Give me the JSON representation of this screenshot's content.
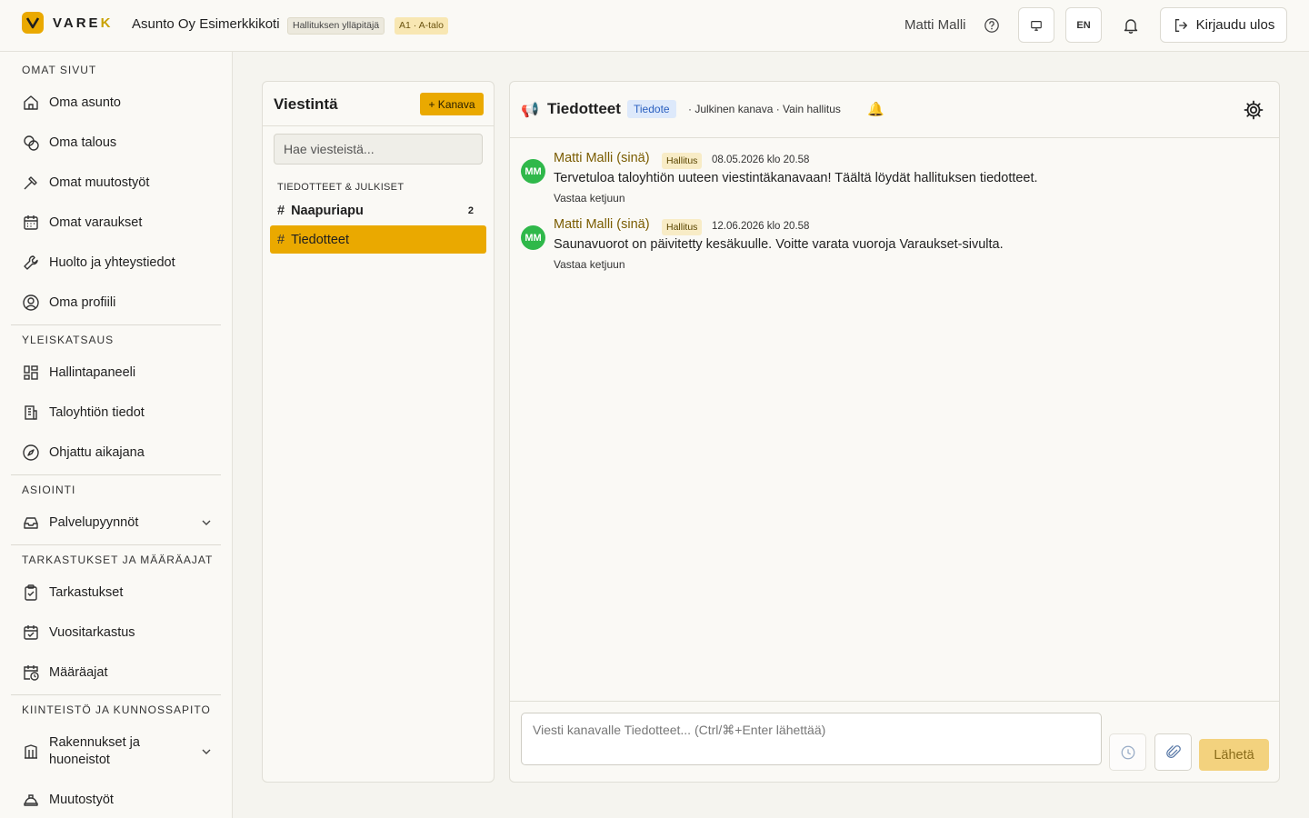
{
  "header": {
    "logo_text_main": "VARE",
    "logo_text_accent": "K",
    "org_name": "Asunto Oy Esimerkkikoti",
    "role_badge": "Hallituksen ylläpitäjä",
    "apartment_badge": "A1 · A-talo",
    "user_name": "Matti Malli",
    "lang_label": "EN",
    "logout_label": "Kirjaudu ulos",
    "accent_color": "#eaa900"
  },
  "sidebar": {
    "sections": [
      {
        "title": "OMAT SIVUT",
        "items": [
          "Oma asunto",
          "Oma talous",
          "Omat muutostyöt",
          "Omat varaukset",
          "Huolto ja yhteystiedot",
          "Oma profiili"
        ]
      },
      {
        "title": "YLEISKATSAUS",
        "items": [
          "Hallintapaneeli",
          "Taloyhtiön tiedot",
          "Ohjattu aikajana"
        ]
      },
      {
        "title": "ASIOINTI",
        "items": [
          "Palvelupyynnöt"
        ]
      },
      {
        "title": "TARKASTUKSET JA MÄÄRÄAJAT",
        "items": [
          "Tarkastukset",
          "Vuositarkastus",
          "Määräajat"
        ]
      },
      {
        "title": "KIINTEISTÖ JA KUNNOSSAPITO",
        "items": [
          "Rakennukset ja",
          "huoneistot",
          "Muutostyöt"
        ]
      }
    ]
  },
  "channels": {
    "title": "Viestintä",
    "add_label": "+ Kanava",
    "search_placeholder": "Hae viesteistä...",
    "group_title": "TIEDOTTEET & JULKISET",
    "items": [
      {
        "hash": "#",
        "name": "Naapuriapu",
        "count": "2"
      },
      {
        "hash": "#",
        "name": "Tiedotteet"
      }
    ]
  },
  "chat": {
    "title": "Tiedotteet",
    "type_badge": "Tiedote",
    "meta": "· Julkinen kanava · Vain hallitus",
    "messages": [
      {
        "initials": "MM",
        "author": "Matti Malli (sinä)",
        "role": "Hallitus",
        "time": "08.05.2026 klo 20.58",
        "text": "Tervetuloa taloyhtiön uuteen viestintäkanavaan! Täältä löydät hallituksen tiedotteet.",
        "reply": "Vastaa ketjuun"
      },
      {
        "initials": "MM",
        "author": "Matti Malli (sinä)",
        "role": "Hallitus",
        "time": "12.06.2026 klo 20.58",
        "text": "Saunavuorot on päivitetty kesäkuulle. Voitte varata vuoroja Varaukset-sivulta.",
        "reply": "Vastaa ketjuun"
      }
    ],
    "composer_placeholder": "Viesti kanavalle Tiedotteet... (Ctrl/⌘+Enter lähettää)",
    "send_label": "Lähetä"
  }
}
